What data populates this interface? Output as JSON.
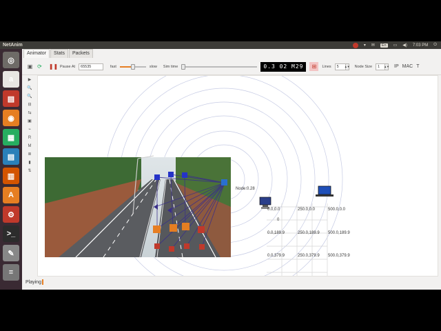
{
  "topbar": {
    "app_title": "NetAnim",
    "lang": "En",
    "volume": "◀)",
    "time": "7:03 PM"
  },
  "launcher": {
    "items": [
      {
        "icon": "ubuntu-icon",
        "glyph": "◎",
        "color": "#6e6b67"
      },
      {
        "icon": "amazon-icon",
        "glyph": "a",
        "color": "#e8e6e3"
      },
      {
        "icon": "files-icon",
        "glyph": "▤",
        "color": "#c0392b"
      },
      {
        "icon": "firefox-icon",
        "glyph": "◉",
        "color": "#e67e22"
      },
      {
        "icon": "calc-icon",
        "glyph": "▦",
        "color": "#27ae60"
      },
      {
        "icon": "writer-icon",
        "glyph": "▤",
        "color": "#2980b9"
      },
      {
        "icon": "impress-icon",
        "glyph": "▥",
        "color": "#d35400"
      },
      {
        "icon": "software-center-icon",
        "glyph": "A",
        "color": "#e67e22"
      },
      {
        "icon": "settings-icon",
        "glyph": "⚙",
        "color": "#c0392b"
      },
      {
        "icon": "terminal-icon",
        "glyph": ">_",
        "color": "#2c2c2c"
      },
      {
        "icon": "editor-icon",
        "glyph": "✎",
        "color": "#888"
      },
      {
        "icon": "trash-icon",
        "glyph": "≡",
        "color": "#777"
      }
    ]
  },
  "tabs": [
    "Animator",
    "Stats",
    "Packets"
  ],
  "toolbar": {
    "pause_label": "Pause At",
    "pause_value": "65535",
    "fast_label": "fast",
    "slow_label": "slow",
    "simtime_label": "Sim time",
    "clock_value": "0.3 02 M29",
    "lines_label": "Lines",
    "lines_value": "5",
    "node_size_label": "Node Size",
    "node_size_value": "1",
    "ip_label": "IP",
    "mac_label": "MAC",
    "t_label": "T",
    "speed_level": 0.5
  },
  "side_tools": [
    "▶",
    "🔍",
    "🔍",
    "⊟",
    "⇆",
    "▣",
    "⌁",
    "R",
    "M",
    "≣",
    "▮",
    "⇅"
  ],
  "canvas": {
    "node_label": "Node:0.28",
    "node_zero": "0",
    "grid_labels": [
      [
        "0.0,0.0",
        "250.0,0.0",
        "500.0,0.0"
      ],
      [
        "0.0,189.9",
        "250.0,189.9",
        "500.0,189.9"
      ],
      [
        "0.0,379.9",
        "250.0,379.9",
        "500.0,379.9"
      ]
    ]
  },
  "status": {
    "text": "Playing"
  }
}
